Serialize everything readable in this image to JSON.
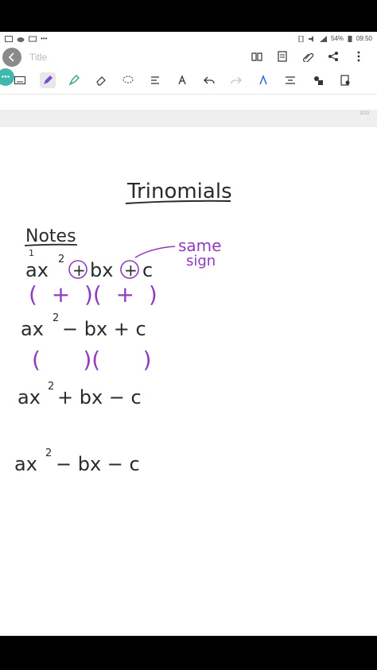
{
  "status": {
    "battery": "54%",
    "time": "09:50"
  },
  "app": {
    "title_placeholder": "Title",
    "page_indicator": "3/13"
  },
  "toolbar": {
    "items": [
      "keyboard-icon",
      "pen-icon",
      "highlighter-icon",
      "eraser-icon",
      "lasso-icon",
      "text-recognition-icon",
      "text-format-icon",
      "undo-icon",
      "redo-icon",
      "voice-recording-icon",
      "insert-icon",
      "shape-icon",
      "page-settings-icon"
    ]
  },
  "header_actions": [
    "book-view-icon",
    "list-view-icon",
    "attach-icon",
    "share-icon",
    "more-icon"
  ],
  "note": {
    "heading": "Trinomials",
    "subheading": "Notes",
    "marker_one": "1",
    "row1": {
      "ax": "ax",
      "exp": "2",
      "plus1": "+",
      "bx": "bx",
      "plus2": "+",
      "c": "c"
    },
    "annotation_line1": "same",
    "annotation_line2": "sign",
    "row1_factors": "(  +  )(  +  )",
    "row2": {
      "ax": "ax",
      "exp": "2",
      "rest": "− bx + c"
    },
    "row2_factors": "(      )(      )",
    "row3": {
      "ax": "ax",
      "exp": "2",
      "rest": "+ bx − c"
    },
    "row4": {
      "ax": "ax",
      "exp": "2",
      "rest": "− bx − c"
    }
  }
}
